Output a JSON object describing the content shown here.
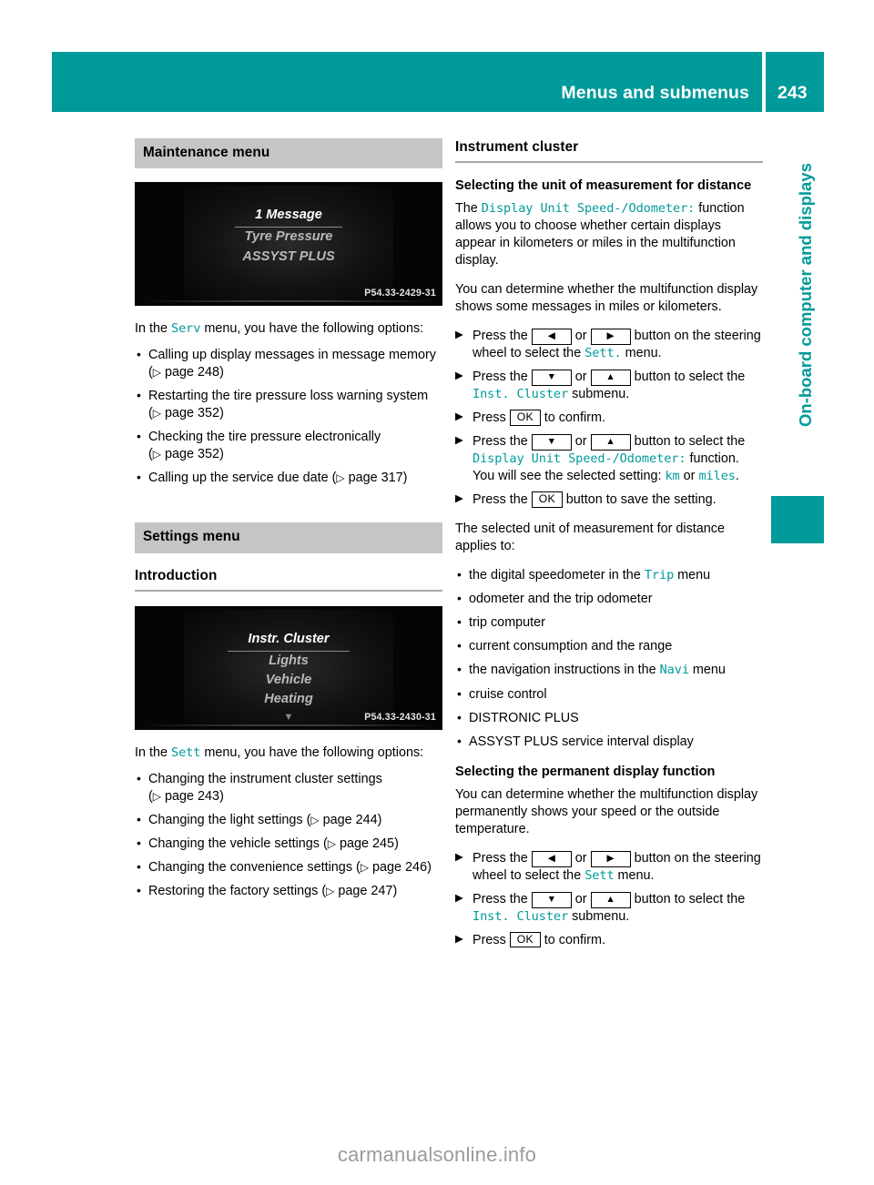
{
  "header": {
    "title": "Menus and submenus",
    "page_number": "243",
    "accent_color": "#009a9a"
  },
  "side_tab": {
    "label": "On-board computer and displays",
    "color": "#009a9a"
  },
  "left_column": {
    "maintenance": {
      "bar_title": "Maintenance menu",
      "figure": {
        "lines": [
          "1 Message",
          "Tyre Pressure",
          "ASSYST PLUS"
        ],
        "caption": "P54.33-2429-31"
      },
      "intro_before": "In the ",
      "intro_menu": "Serv",
      "intro_after": " menu, you have the following options:",
      "options": [
        {
          "text": "Calling up display messages in message memory (",
          "ref": "page 248",
          "tail": ")"
        },
        {
          "text": "Restarting the tire pressure loss warning system (",
          "ref": "page 352",
          "tail": ")"
        },
        {
          "text": "Checking the tire pressure electronically (",
          "ref": "page 352",
          "tail": ")"
        },
        {
          "text": "Calling up the service due date (",
          "ref": "page 317",
          "tail": ")"
        }
      ]
    },
    "settings": {
      "bar_title": "Settings menu",
      "heading": "Introduction",
      "figure": {
        "lines": [
          "Instr. Cluster",
          "Lights",
          "Vehicle",
          "Heating"
        ],
        "caption": "P54.33-2430-31"
      },
      "intro_before": "In the ",
      "intro_menu": "Sett",
      "intro_after": " menu, you have the following options:",
      "options": [
        {
          "text": "Changing the instrument cluster settings (",
          "ref": "page 243",
          "tail": ")"
        },
        {
          "text": "Changing the light settings (",
          "ref": "page 244",
          "tail": ")"
        },
        {
          "text": "Changing the vehicle settings (",
          "ref": "page 245",
          "tail": ")"
        },
        {
          "text": "Changing the convenience settings (",
          "ref": "page 246",
          "tail": ")"
        },
        {
          "text": "Restoring the factory settings (",
          "ref": "page 247",
          "tail": ")"
        }
      ]
    }
  },
  "right_column": {
    "heading": "Instrument cluster",
    "unit_section": {
      "subheading": "Selecting the unit of measurement for distance",
      "para1_before": "The ",
      "para1_code": "Display Unit Speed-/Odometer:",
      "para1_after": " function allows you to choose whether certain displays appear in kilometers or miles in the multifunction display.",
      "para2": "You can determine whether the multifunction display shows some messages in miles or kilometers.",
      "step1_a": "Press the ",
      "step1_key_left": "◀",
      "step1_or": " or ",
      "step1_key_right": "▶",
      "step1_b": " button on the steering wheel to select the ",
      "step1_menu": "Sett.",
      "step1_c": " menu.",
      "step2_a": "Press the ",
      "step2_key_down": "▼",
      "step2_or": " or ",
      "step2_key_up": "▲",
      "step2_b": " button to select the ",
      "step2_menu": "Inst. Cluster",
      "step2_c": " submenu.",
      "step3_a": "Press ",
      "step3_key": "OK",
      "step3_b": " to confirm.",
      "step4_a": "Press the ",
      "step4_key_down": "▼",
      "step4_or": " or ",
      "step4_key_up": "▲",
      "step4_b": " button to select the ",
      "step4_code": "Display Unit Speed-/Odometer:",
      "step4_c": " function.",
      "step4_d": "You will see the selected setting: ",
      "step4_unit_km": "km",
      "step4_e": " or ",
      "step4_unit_miles": "miles",
      "step4_f": ".",
      "step5_a": "Press the ",
      "step5_key": "OK",
      "step5_b": " button to save the setting.",
      "applies_intro": "The selected unit of measurement for distance applies to:",
      "applies_items": [
        {
          "before": "the digital speedometer in the ",
          "code": "Trip",
          "after": " menu"
        },
        {
          "before": "odometer and the trip odometer",
          "code": "",
          "after": ""
        },
        {
          "before": "trip computer",
          "code": "",
          "after": ""
        },
        {
          "before": "current consumption and the range",
          "code": "",
          "after": ""
        },
        {
          "before": "the navigation instructions in the ",
          "code": "Navi",
          "after": " menu"
        },
        {
          "before": "cruise control",
          "code": "",
          "after": ""
        },
        {
          "before": "DISTRONIC PLUS",
          "code": "",
          "after": ""
        },
        {
          "before": "ASSYST PLUS service interval display",
          "code": "",
          "after": ""
        }
      ]
    },
    "permanent_section": {
      "subheading": "Selecting the permanent display function",
      "para1": "You can determine whether the multifunction display permanently shows your speed or the outside temperature.",
      "step1_a": "Press the ",
      "step1_key_left": "◀",
      "step1_or": " or ",
      "step1_key_right": "▶",
      "step1_b": " button on the steering wheel to select the ",
      "step1_menu": "Sett",
      "step1_c": " menu.",
      "step2_a": "Press the ",
      "step2_key_down": "▼",
      "step2_or": " or ",
      "step2_key_up": "▲",
      "step2_b": " button to select the ",
      "step2_menu": "Inst. Cluster",
      "step2_c": " submenu.",
      "step3_a": "Press ",
      "step3_key": "OK",
      "step3_b": " to confirm."
    }
  },
  "watermark": "carmanualsonline.info"
}
